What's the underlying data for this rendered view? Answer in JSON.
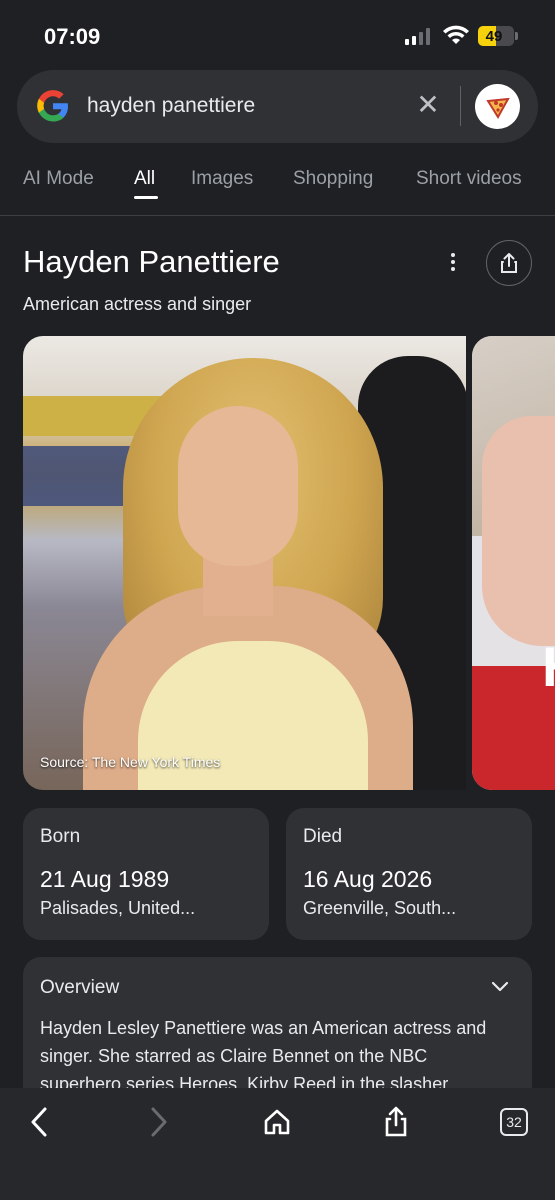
{
  "status": {
    "time": "07:09",
    "battery_level": "49",
    "battery_fraction": 0.49,
    "battery_color": "#f5d20c"
  },
  "search": {
    "query": "hayden panettiere",
    "clear_icon": "close-icon",
    "logo": "google-logo",
    "avatar": "profile-avatar"
  },
  "tabs": [
    "AI Mode",
    "All",
    "Images",
    "Shopping",
    "Short videos"
  ],
  "active_tab": "All",
  "entity": {
    "title": "Hayden Panettiere",
    "subtitle": "American actress and singer",
    "image_source": "Source: The New York Times",
    "second_image_letter": "H"
  },
  "facts": {
    "born": {
      "label": "Born",
      "date": "21 Aug 1989",
      "place": "Palisades, United..."
    },
    "died": {
      "label": "Died",
      "date": "16 Aug 2026",
      "place": "Greenville, South..."
    }
  },
  "overview": {
    "title": "Overview",
    "text": "Hayden Lesley Panettiere was an American actress and singer. She starred as Claire Bennet on the NBC superhero series Heroes, Kirby Reed in the slasher"
  },
  "toolbar": {
    "tab_count": "32"
  },
  "colors": {
    "background": "#1f2024",
    "card": "#303134",
    "accent_text": "#e8eaed"
  }
}
